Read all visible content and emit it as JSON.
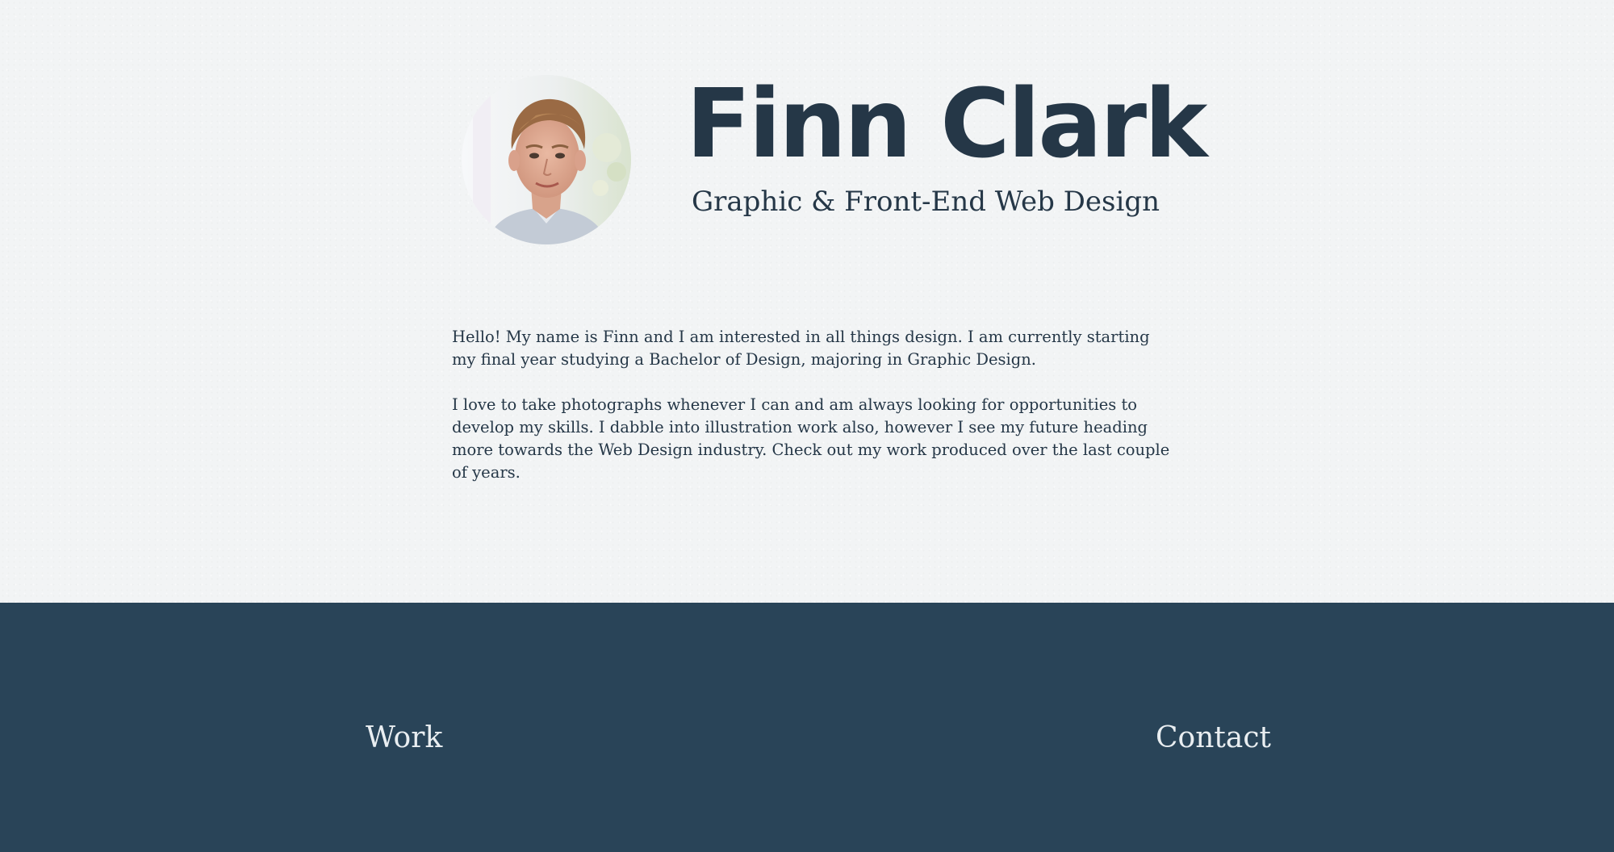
{
  "profile": {
    "name": "Finn Clark",
    "tagline": "Graphic & Front-End Web Design",
    "avatar_icon": "portrait-photo"
  },
  "about": {
    "paragraphs": [
      "Hello! My name is Finn and I am interested in all things design. I am currently starting my final year studying a Bachelor of Design, majoring in Graphic Design.",
      "I love to take photographs whenever I can and am always looking for opportunities to develop my skills. I dabble into illustration work also, however I see my future heading more towards the Web Design industry. Check out my work produced over the last couple of years."
    ]
  },
  "footer": {
    "work_label": "Work",
    "contact_label": "Contact"
  },
  "colors": {
    "background": "#f2f4f5",
    "text": "#253747",
    "footer_background": "#294458",
    "footer_text": "#e9eef1"
  }
}
